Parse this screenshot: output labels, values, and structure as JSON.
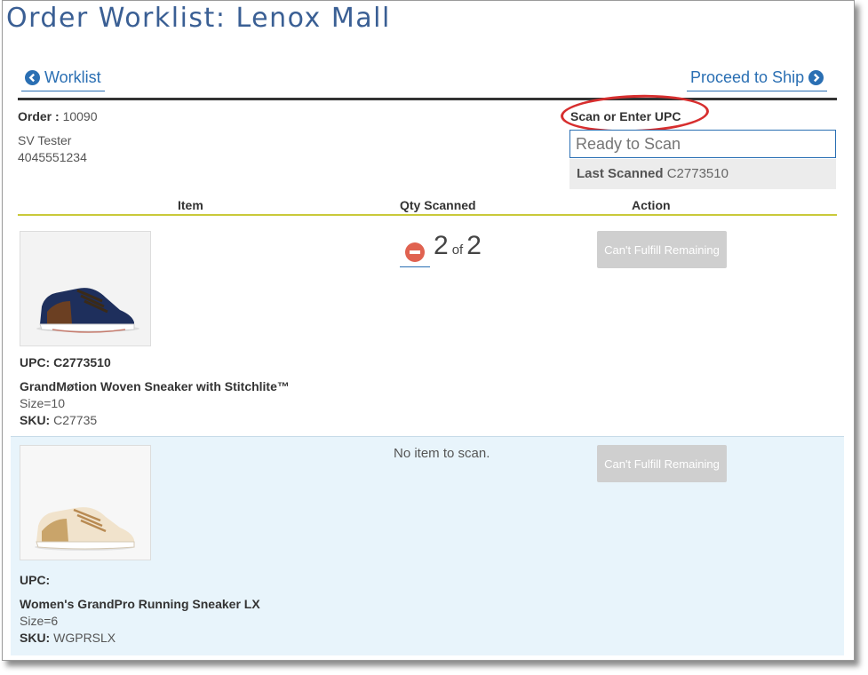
{
  "page": {
    "title": "Order Worklist: Lenox Mall"
  },
  "nav": {
    "back_label": "Worklist",
    "next_label": "Proceed to Ship"
  },
  "order": {
    "label": "Order :",
    "number": "10090",
    "customer_name": "SV Tester",
    "customer_phone": "4045551234"
  },
  "scan": {
    "label": "Scan or Enter UPC",
    "placeholder": "Ready to Scan",
    "last_scanned_label": "Last Scanned",
    "last_scanned_value": "C2773510"
  },
  "table": {
    "headers": [
      "Item",
      "Qty Scanned",
      "Action"
    ],
    "rows": [
      {
        "upc_label": "UPC: C2773510",
        "name": "GrandMøtion Woven Sneaker with Stitchlite™",
        "size": "Size=10",
        "sku_label": "SKU:",
        "sku_value": "C27735",
        "qty_scanned": "2",
        "qty_of": "of",
        "qty_total": "2",
        "action_label": "Can't Fulfill Remaining"
      },
      {
        "upc_label": "UPC:",
        "name": "Women's GrandPro Running Sneaker LX",
        "size": "Size=6",
        "sku_label": "SKU:",
        "sku_value": "WGPRSLX",
        "no_item_text": "No item to scan.",
        "action_label": "Can't Fulfill Remaining"
      }
    ]
  },
  "colors": {
    "title": "#3a5f94",
    "link": "#2a6fb3",
    "highlight_oval": "#d72e2e",
    "row_highlight": "#e8f4fb",
    "divider": "#c9c93a"
  }
}
